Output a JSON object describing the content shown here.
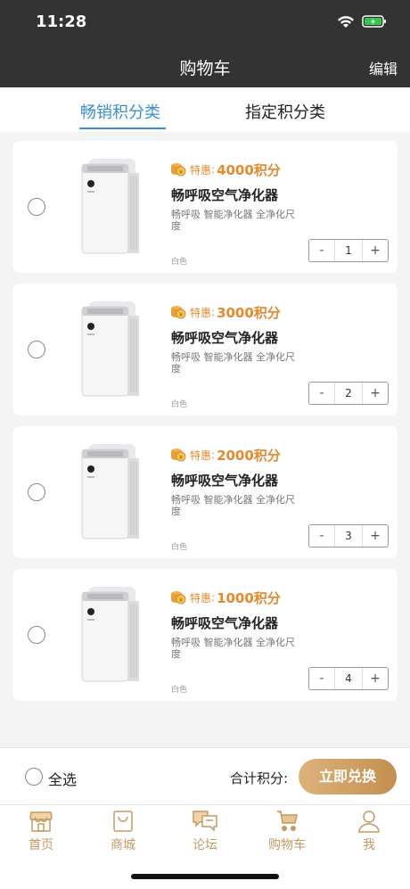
{
  "status_bar": {
    "time": "11:28"
  },
  "nav": {
    "title": "购物车",
    "edit_label": "编辑"
  },
  "tabs": [
    {
      "label": "畅销积分类",
      "active": true
    },
    {
      "label": "指定积分类",
      "active": false
    }
  ],
  "cart_items": [
    {
      "price_label": "特惠",
      "price_colon": ":",
      "price_value": "4000积分",
      "name": "畅呼吸空气净化器",
      "desc": "畅呼吸 智能净化器 全净化尺度",
      "color": "白色",
      "qty_minus": "-",
      "quantity": "1",
      "qty_plus": "+"
    },
    {
      "price_label": "特惠",
      "price_colon": ":",
      "price_value": "3000积分",
      "name": "畅呼吸空气净化器",
      "desc": "畅呼吸 智能净化器 全净化尺度",
      "color": "白色",
      "qty_minus": "-",
      "quantity": "2",
      "qty_plus": "+"
    },
    {
      "price_label": "特惠",
      "price_colon": ":",
      "price_value": "2000积分",
      "name": "畅呼吸空气净化器",
      "desc": "畅呼吸 智能净化器 全净化尺度",
      "color": "白色",
      "qty_minus": "-",
      "quantity": "3",
      "qty_plus": "+"
    },
    {
      "price_label": "特惠",
      "price_colon": ":",
      "price_value": "1000积分",
      "name": "畅呼吸空气净化器",
      "desc": "畅呼吸 智能净化器 全净化尺度",
      "color": "白色",
      "qty_minus": "-",
      "quantity": "4",
      "qty_plus": "+"
    }
  ],
  "footer": {
    "select_all": "全选",
    "total_label": "合计积分:",
    "redeem_button": "立即兑换"
  },
  "tab_bar": [
    {
      "label": "首页",
      "icon": "shop-front-icon"
    },
    {
      "label": "商城",
      "icon": "shopping-bag-icon"
    },
    {
      "label": "论坛",
      "icon": "chat-bubbles-icon"
    },
    {
      "label": "购物车",
      "icon": "cart-icon",
      "active": true
    },
    {
      "label": "我",
      "icon": "person-icon"
    }
  ],
  "colors": {
    "header_bg": "#333333",
    "accent_blue": "#3b8fd6",
    "price_orange": "#e48a2c",
    "gold": "#c59a62"
  }
}
